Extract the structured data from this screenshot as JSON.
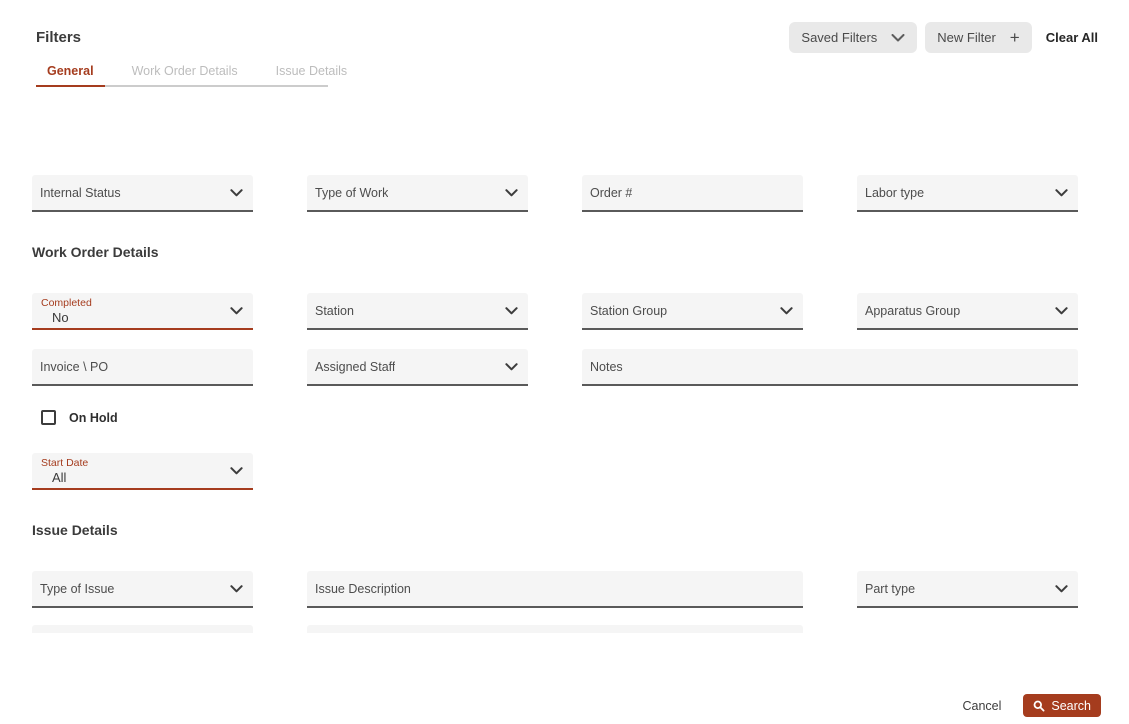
{
  "panel": {
    "title": "Filters",
    "actions": {
      "saved_filters": "Saved Filters",
      "new_filter": "New Filter",
      "plus_glyph": "+",
      "clear_all": "Clear All"
    },
    "tabs": {
      "general": "General",
      "work_order_details": "Work Order Details",
      "issue_details": "Issue Details"
    }
  },
  "sections": {
    "work_order_details": "Work Order Details",
    "issue_details": "Issue Details"
  },
  "filters": {
    "internal_status": "Internal Status",
    "type_of_work": "Type of Work",
    "order_number": "Order #",
    "labor_type": "Labor type",
    "completed_label": "Completed",
    "completed_value": "No",
    "station": "Station",
    "station_group": "Station Group",
    "apparatus_group": "Apparatus Group",
    "invoice_po": "Invoice \\ PO",
    "assigned_staff": "Assigned Staff",
    "notes": "Notes",
    "on_hold": "On Hold",
    "start_date_label": "Start Date",
    "start_date_value": "All",
    "type_of_issue": "Type of Issue",
    "issue_description": "Issue Description",
    "part_type": "Part type"
  },
  "footer": {
    "cancel": "Cancel",
    "search": "Search"
  },
  "icons": {
    "select_chevron": "chevron-down",
    "saved_filters_chevron": "chevron-down",
    "new_filter": "plus",
    "search": "magnifier"
  },
  "colors": {
    "accent": "#a53c1e",
    "field_bg": "#f5f5f5",
    "field_border": "#5a5a5a",
    "chip_bg": "#e9e9e9",
    "inactive_tab": "#bdbdbd",
    "text_dark": "#3c3c3c",
    "text_muted": "#4d4d4d",
    "tab_line": "#cccccc"
  }
}
